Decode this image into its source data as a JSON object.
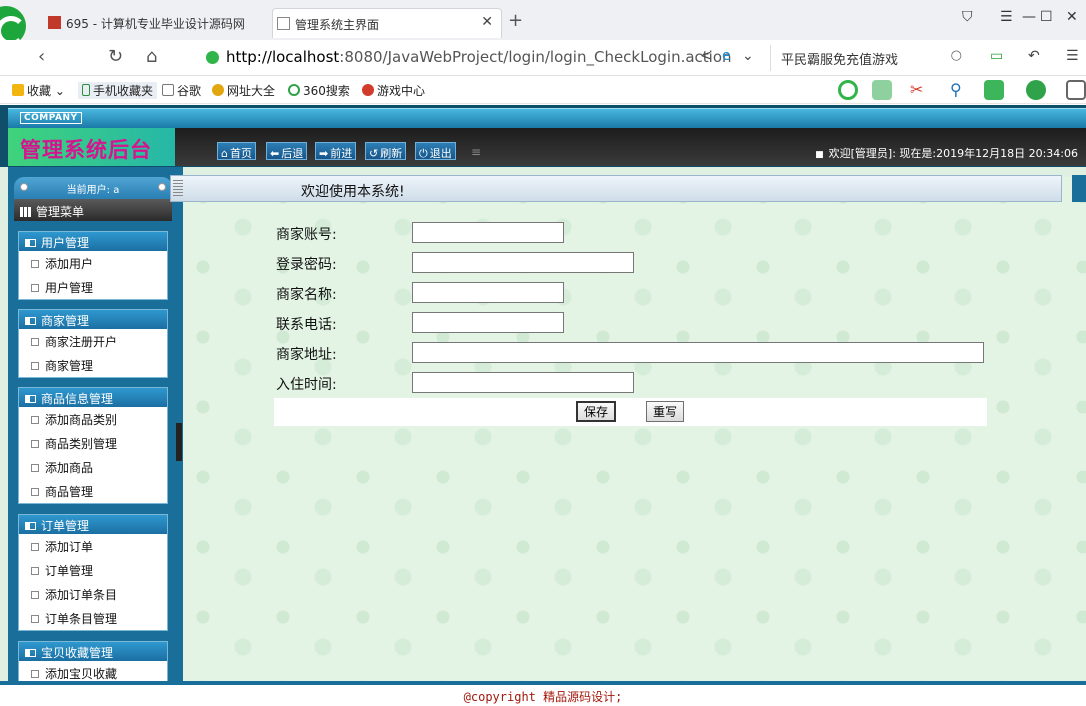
{
  "browser": {
    "tabs": [
      {
        "title": "695 - 计算机专业毕业设计源码网"
      },
      {
        "title": "管理系统主界面"
      }
    ],
    "url_host": "http://localhost",
    "url_rest": ":8080/JavaWebProject/login/login_CheckLogin.action",
    "search_text": "平民霸服免充值游戏",
    "bookmarks": [
      "收藏",
      "手机收藏夹",
      "谷歌",
      "网址大全",
      "360搜索",
      "游戏中心"
    ]
  },
  "app": {
    "company": "COMPANY",
    "title": "管理系统后台",
    "nav_buttons": [
      "首页",
      "后退",
      "前进",
      "刷新",
      "退出"
    ],
    "status": "欢迎[管理员]:  现在是:2019年12月18日 20:34:06",
    "current_user": "当前用户: a",
    "menu_title": "管理菜单",
    "welcome": "欢迎使用本系统!",
    "menu_groups": [
      {
        "title": "用户管理",
        "items": [
          "添加用户",
          "用户管理"
        ]
      },
      {
        "title": "商家管理",
        "items": [
          "商家注册开户",
          "商家管理"
        ]
      },
      {
        "title": "商品信息管理",
        "items": [
          "添加商品类别",
          "商品类别管理",
          "添加商品",
          "商品管理"
        ]
      },
      {
        "title": "订单管理",
        "items": [
          "添加订单",
          "订单管理",
          "添加订单条目",
          "订单条目管理"
        ]
      },
      {
        "title": "宝贝收藏管理",
        "items": [
          "添加宝贝收藏"
        ]
      }
    ],
    "form": {
      "account_label": "商家账号:",
      "password_label": "登录密码:",
      "name_label": "商家名称:",
      "phone_label": "联系电话:",
      "address_label": "商家地址:",
      "date_label": "入住时间:",
      "save": "保存",
      "reset": "重写"
    },
    "footer": "@copyright 精品源码设计;"
  }
}
